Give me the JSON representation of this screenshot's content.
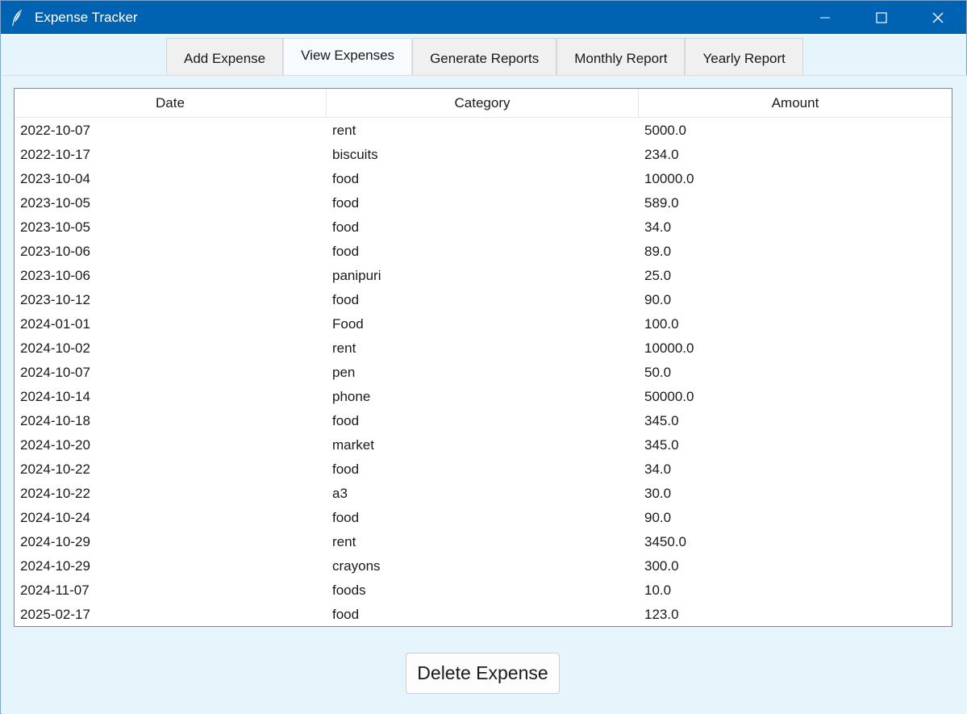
{
  "window": {
    "title": "Expense Tracker",
    "icon": "feather-icon",
    "accent": "#0063b1"
  },
  "tabs": [
    {
      "label": "Add Expense",
      "active": false
    },
    {
      "label": "View Expenses",
      "active": true
    },
    {
      "label": "Generate Reports",
      "active": false
    },
    {
      "label": "Monthly Report",
      "active": false
    },
    {
      "label": "Yearly Report",
      "active": false
    }
  ],
  "table": {
    "columns": [
      "Date",
      "Category",
      "Amount"
    ],
    "rows": [
      [
        "2022-10-07",
        "rent",
        "5000.0"
      ],
      [
        "2022-10-17",
        "biscuits",
        "234.0"
      ],
      [
        "2023-10-04",
        "food",
        "10000.0"
      ],
      [
        "2023-10-05",
        "food",
        "589.0"
      ],
      [
        "2023-10-05",
        "food",
        "34.0"
      ],
      [
        "2023-10-06",
        "food",
        "89.0"
      ],
      [
        "2023-10-06",
        "panipuri",
        "25.0"
      ],
      [
        "2023-10-12",
        "food",
        "90.0"
      ],
      [
        "2024-01-01",
        "Food",
        "100.0"
      ],
      [
        "2024-10-02",
        "rent",
        "10000.0"
      ],
      [
        "2024-10-07",
        "pen",
        "50.0"
      ],
      [
        "2024-10-14",
        "phone",
        "50000.0"
      ],
      [
        "2024-10-18",
        "food",
        "345.0"
      ],
      [
        "2024-10-20",
        "market",
        "345.0"
      ],
      [
        "2024-10-22",
        "food",
        "34.0"
      ],
      [
        "2024-10-22",
        "a3",
        "30.0"
      ],
      [
        "2024-10-24",
        "food",
        "90.0"
      ],
      [
        "2024-10-29",
        "rent",
        "3450.0"
      ],
      [
        "2024-10-29",
        "crayons",
        "300.0"
      ],
      [
        "2024-11-07",
        "foods",
        "10.0"
      ],
      [
        "2025-02-17",
        "food",
        "123.0"
      ]
    ]
  },
  "actions": {
    "delete_label": "Delete Expense"
  }
}
